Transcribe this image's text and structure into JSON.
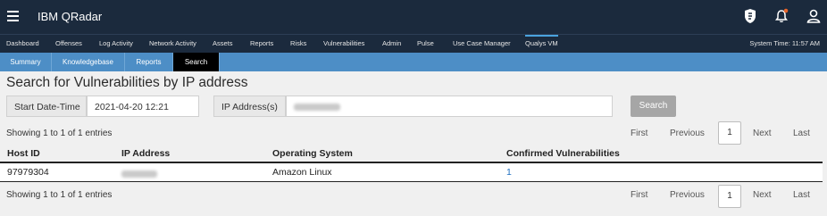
{
  "app": {
    "title": "IBM QRadar"
  },
  "nav": {
    "items": [
      "Dashboard",
      "Offenses",
      "Log Activity",
      "Network Activity",
      "Assets",
      "Reports",
      "Risks",
      "Vulnerabilities",
      "Admin",
      "Pulse",
      "Use Case Manager",
      "Qualys VM"
    ],
    "active": "Qualys VM",
    "system_time": "System Time: 11:57 AM"
  },
  "subtabs": {
    "items": [
      "Summary",
      "Knowledgebase",
      "Reports",
      "Search"
    ],
    "active": "Search"
  },
  "page": {
    "heading": "Search for Vulnerabilities by IP address"
  },
  "filters": {
    "start_label": "Start Date-Time",
    "start_value": "2021-04-20 12:21",
    "ip_label": "IP Address(s)",
    "ip_value": "",
    "search_button": "Search"
  },
  "pagination": {
    "info": "Showing 1 to 1 of 1 entries",
    "first": "First",
    "previous": "Previous",
    "current": "1",
    "next": "Next",
    "last": "Last"
  },
  "table": {
    "headers": [
      "Host ID",
      "IP Address",
      "Operating System",
      "Confirmed Vulnerabilities"
    ],
    "rows": [
      {
        "host_id": "97979304",
        "ip": "",
        "os": "Amazon Linux",
        "vulns": "1"
      }
    ]
  },
  "colors": {
    "topbar": "#1b2a3d",
    "subtab_bar": "#4d8ec6",
    "active_subtab": "#000000",
    "link": "#1f6fc0"
  }
}
